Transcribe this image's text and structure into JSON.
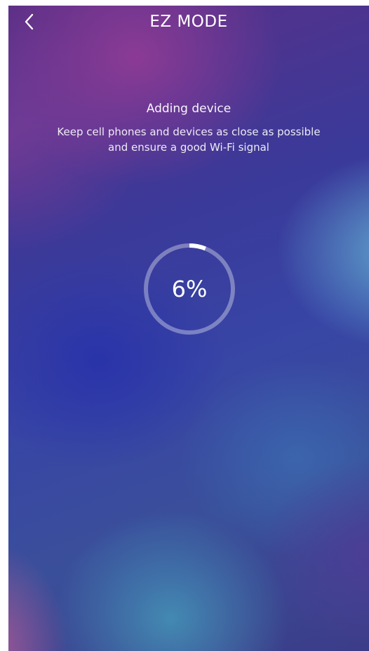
{
  "header": {
    "title": "EZ MODE",
    "back_icon": "chevron-left-icon"
  },
  "status": {
    "heading": "Adding device",
    "message": "Keep cell phones and devices as close as possible and ensure a good Wi-Fi signal"
  },
  "progress": {
    "label": "6%",
    "fraction": 0.06
  },
  "colors": {
    "text": "#ffffff",
    "ring_track": "rgba(255,255,255,0.35)",
    "ring_fill": "#ffffff"
  }
}
